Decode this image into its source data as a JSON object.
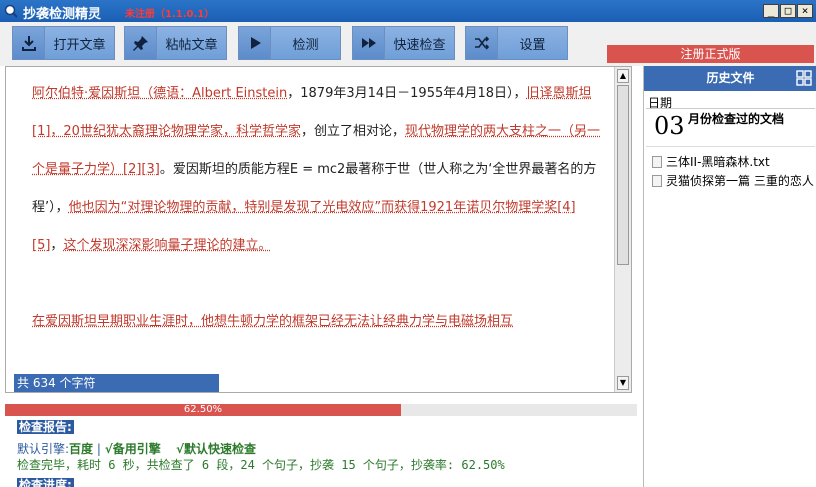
{
  "window": {
    "title": "抄袭检测精灵",
    "version": "未注册（1.1.0.1）",
    "controls": [
      "_",
      "□",
      "×"
    ]
  },
  "toolbar": {
    "open_label": "打开文章",
    "paste_label": "粘帖文章",
    "detect_label": "检测",
    "quick_label": "快速检查",
    "settings_label": "设置",
    "register_label": "注册正式版"
  },
  "editor": {
    "segments": [
      {
        "t": "阿尔伯特·爱因斯坦（德语：Albert Einstein",
        "hl": true
      },
      {
        "t": "，1879年3月14日－1955年4月18日），",
        "hl": false
      },
      {
        "t": "犹太裔理论物理学家，科学哲学家",
        "hl": true,
        "pre": "旧译恩斯坦[1]，20世纪"
      },
      {
        "t": "，创立了相对论，",
        "hl": false
      },
      {
        "t": "现代物理学的两大支柱之一（另一个是量子力学）[2][3]",
        "hl": true
      },
      {
        "t": "。爱因斯坦的质能方程E = mc2最著称于世（世人称之为‘全世界最著名的方程’），",
        "hl": false
      },
      {
        "t": "他也因为“对理论物理的贡献，特别是发现了光电效应”而获得1921年诺贝尔物理学奖[4][5]",
        "hl": true
      },
      {
        "t": "，",
        "hl": false
      },
      {
        "t": "这个发现深深影响量子理论的建立。",
        "hl": true
      }
    ],
    "para2": "在爱因斯坦早期职业生涯时，他想牛顿力学的框架已经无法让经典力学与电磁场相互",
    "char_count": "共 634 个字符"
  },
  "progress": {
    "value": 0.625,
    "label": "62.50%"
  },
  "report": {
    "title": "检查报告:",
    "engine_prefix": "默认引擎:",
    "engine": "百度",
    "sep": " | ",
    "backup": "√备用引擎",
    "quick": "√默认快速检查",
    "summary": "检查完毕，耗时 6  秒，共检查了 6 段，24 个句子，抄袭 15 个句子，抄袭率: 62.50%",
    "progress_title": "检查进度:"
  },
  "history": {
    "header": "历史文件",
    "date_label": "日期",
    "day": "03",
    "month_text": "月份检查过的文档",
    "files": [
      "三体II-黑暗森林.txt",
      "灵猫侦探第一篇 三重的恋人"
    ]
  },
  "colors": {
    "accent": "#3b6cb3",
    "highlight": "#c0392b",
    "progress": "#d9534f"
  }
}
